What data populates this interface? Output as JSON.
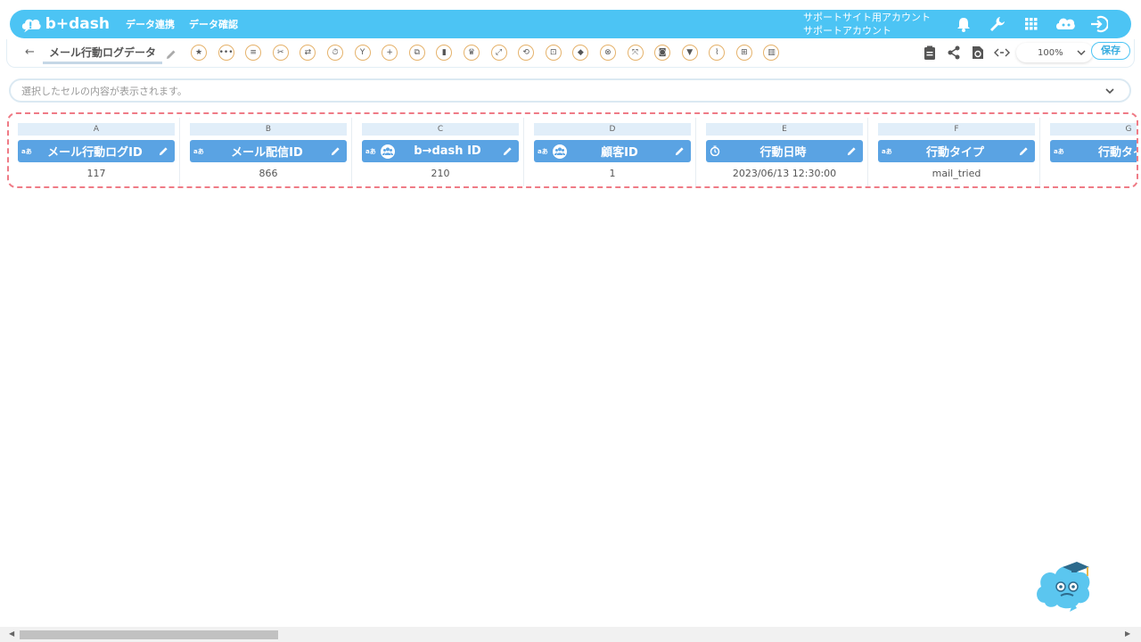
{
  "app": {
    "name": "b+dash"
  },
  "nav": [
    {
      "label": "データ連携"
    },
    {
      "label": "データ確認"
    }
  ],
  "account": {
    "line1": "サポートサイト用アカウント",
    "line2": "サポートアカウント"
  },
  "top_icons": [
    "bell-icon",
    "wrench-icon",
    "grid-icon",
    "mascot-face-icon",
    "logout-icon"
  ],
  "toolbar": {
    "back": "←",
    "sheet_name": "メール行動ログデータ",
    "tools": [
      "star-icon",
      "more-icon",
      "list-icon",
      "scissors-icon",
      "merge-icon",
      "timer-icon",
      "branch-icon",
      "plus-icon",
      "copy-icon",
      "trash-icon",
      "crown-icon",
      "expand-icon",
      "repeat-icon",
      "lock-icon",
      "box-icon",
      "cancel-icon",
      "pivot-icon",
      "camera-icon",
      "filter-icon",
      "split-icon",
      "table-icon",
      "columns-icon"
    ],
    "right_tools": [
      "clipboard-icon",
      "share-icon",
      "sync-icon",
      "code-icon"
    ],
    "zoom": "100%",
    "save_label": "保存"
  },
  "cellbar": {
    "placeholder": "選択したセルの内容が表示されます。"
  },
  "columns": [
    {
      "letter": "A",
      "type": "aあ",
      "people": false,
      "clock": false,
      "label": "メール行動ログID",
      "value": "117"
    },
    {
      "letter": "B",
      "type": "aあ",
      "people": false,
      "clock": false,
      "label": "メール配信ID",
      "value": "866"
    },
    {
      "letter": "C",
      "type": "aあ",
      "people": true,
      "clock": false,
      "label": "b→dash ID",
      "value": "210"
    },
    {
      "letter": "D",
      "type": "aあ",
      "people": true,
      "clock": false,
      "label": "顧客ID",
      "value": "1"
    },
    {
      "letter": "E",
      "type": "",
      "people": false,
      "clock": true,
      "label": "行動日時",
      "value": "2023/06/13 12:30:00"
    },
    {
      "letter": "F",
      "type": "aあ",
      "people": false,
      "clock": false,
      "label": "行動タイプ",
      "value": "mail_tried"
    },
    {
      "letter": "G",
      "type": "aあ",
      "people": false,
      "clock": false,
      "label": "行動タイプ",
      "value": ""
    }
  ],
  "colors": {
    "brand": "#4cc4f4",
    "header": "#5aa3e3",
    "highlight": "#ef7b86"
  }
}
